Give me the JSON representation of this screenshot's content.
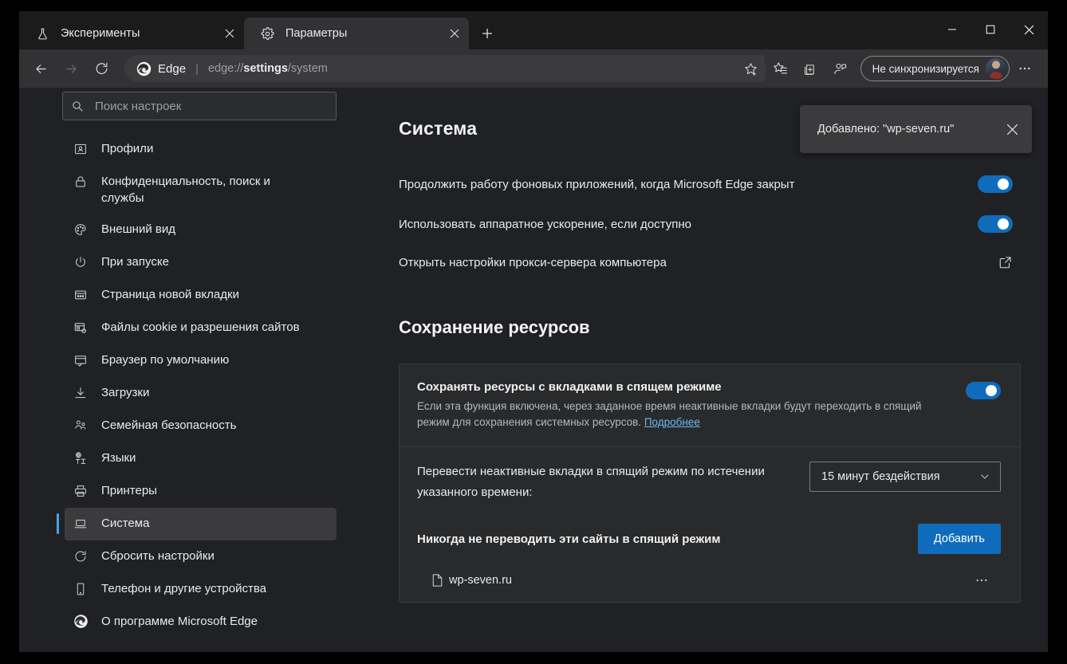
{
  "window": {
    "controls": {
      "minimize": "minimize-icon",
      "maximize": "maximize-icon",
      "close": "close-icon"
    }
  },
  "tabs": [
    {
      "title": "Эксперименты",
      "icon": "flask-icon",
      "active": false
    },
    {
      "title": "Параметры",
      "icon": "gear-icon",
      "active": true
    }
  ],
  "newtab_label": "+",
  "toolbar": {
    "back": "back-arrow-icon",
    "forward": "forward-arrow-icon",
    "reload": "reload-icon",
    "brand": "Edge",
    "separator": "|",
    "url_prefix": "edge://",
    "url_bold": "settings",
    "url_suffix": "/system",
    "favorite": "star-plus-icon",
    "favorites_bar": "favorites-list-icon",
    "collections": "collections-icon",
    "profile_icon": "profile-feedback-icon",
    "sync_status": "Не синхронизируется",
    "more": "ellipsis-icon"
  },
  "sidebar": {
    "search": {
      "placeholder": "Поиск настроек",
      "value": ""
    },
    "items": [
      {
        "label": "Профили",
        "icon": "profile-card-icon",
        "selected": false
      },
      {
        "label": "Конфиденциальность, поиск и службы",
        "icon": "lock-icon",
        "selected": false
      },
      {
        "label": "Внешний вид",
        "icon": "palette-icon",
        "selected": false
      },
      {
        "label": "При запуске",
        "icon": "power-icon",
        "selected": false
      },
      {
        "label": "Страница новой вкладки",
        "icon": "new-tab-page-icon",
        "selected": false
      },
      {
        "label": "Файлы cookie и разрешения сайтов",
        "icon": "cookie-permissions-icon",
        "selected": false
      },
      {
        "label": "Браузер по умолчанию",
        "icon": "default-browser-icon",
        "selected": false
      },
      {
        "label": "Загрузки",
        "icon": "download-icon",
        "selected": false
      },
      {
        "label": "Семейная безопасность",
        "icon": "family-safety-icon",
        "selected": false
      },
      {
        "label": "Языки",
        "icon": "languages-icon",
        "selected": false
      },
      {
        "label": "Принтеры",
        "icon": "printer-icon",
        "selected": false
      },
      {
        "label": "Система",
        "icon": "laptop-icon",
        "selected": true
      },
      {
        "label": "Сбросить настройки",
        "icon": "reset-icon",
        "selected": false
      },
      {
        "label": "Телефон и другие устройства",
        "icon": "phone-icon",
        "selected": false
      },
      {
        "label": "О программе Microsoft Edge",
        "icon": "edge-logo-icon",
        "selected": false
      }
    ]
  },
  "main": {
    "heading": "Система",
    "settings": [
      {
        "label": "Продолжить работу фоновых приложений, когда Microsoft Edge закрыт",
        "control": "toggle",
        "state": "on"
      },
      {
        "label": "Использовать аппаратное ускорение, если доступно",
        "control": "toggle",
        "state": "on"
      },
      {
        "label": "Открыть настройки прокси-сервера компьютера",
        "control": "external-link",
        "state": ""
      }
    ],
    "section2": {
      "heading": "Сохранение ресурсов",
      "card": {
        "title": "Сохранять ресурсы с вкладками в спящем режиме",
        "toggle_state": "on",
        "description_part1": "Если эта функция включена, через заданное время неактивные вкладки будут переходить в спящий режим для сохранения системных ресурсов. ",
        "description_link": "Подробнее",
        "timer_label": "Перевести неактивные вкладки в спящий режим по истечении указанного времени:",
        "timer_value": "15 минут бездействия",
        "never_label": "Никогда не переводить эти сайты в спящий режим",
        "add_button": "Добавить",
        "sites": [
          {
            "name": "wp-seven.ru",
            "icon": "document-icon",
            "menu": "⋯"
          }
        ]
      }
    }
  },
  "toast": {
    "message": "Добавлено: \"wp-seven.ru\"",
    "close": "close-icon"
  },
  "colors": {
    "accent": "#0f6cbd",
    "selection_bar": "#4ba0e8",
    "link": "#6cb8f5",
    "window_bg": "#202124",
    "toolbar_bg": "#323234",
    "tabbar_bg": "#1b1b1b",
    "card_bg": "#292a2c"
  }
}
